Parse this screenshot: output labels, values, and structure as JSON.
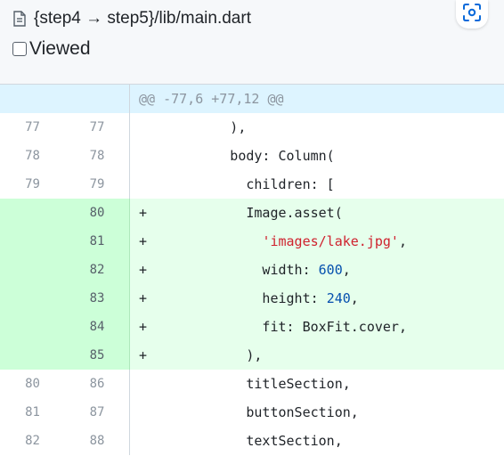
{
  "file": {
    "path": "{step4 → step5}/lib/main.dart",
    "viewed_label": "Viewed",
    "viewed": false
  },
  "icons": {
    "file": "file-diff-icon",
    "scan": "scan-focus-icon"
  },
  "colors": {
    "addition_bg": "#e6ffec",
    "addition_ln_bg": "#ccffd8",
    "hunk_bg": "#ddf4ff",
    "string": "#cf222e",
    "number": "#0550ae"
  },
  "diff": {
    "hunk_header": "@@ -77,6 +77,12 @@",
    "lines": [
      {
        "old": "77",
        "new": "77",
        "marker": "",
        "type": "context",
        "parts": [
          {
            "t": "          ),",
            "k": ""
          }
        ]
      },
      {
        "old": "78",
        "new": "78",
        "marker": "",
        "type": "context",
        "parts": [
          {
            "t": "          body: Column(",
            "k": ""
          }
        ]
      },
      {
        "old": "79",
        "new": "79",
        "marker": "",
        "type": "context",
        "parts": [
          {
            "t": "            children: [",
            "k": ""
          }
        ]
      },
      {
        "old": "",
        "new": "80",
        "marker": "+",
        "type": "add",
        "parts": [
          {
            "t": "            Image.asset(",
            "k": ""
          }
        ]
      },
      {
        "old": "",
        "new": "81",
        "marker": "+",
        "type": "add",
        "parts": [
          {
            "t": "              ",
            "k": ""
          },
          {
            "t": "'images/lake.jpg'",
            "k": "str"
          },
          {
            "t": ",",
            "k": ""
          }
        ]
      },
      {
        "old": "",
        "new": "82",
        "marker": "+",
        "type": "add",
        "parts": [
          {
            "t": "              width: ",
            "k": ""
          },
          {
            "t": "600",
            "k": "num"
          },
          {
            "t": ",",
            "k": ""
          }
        ]
      },
      {
        "old": "",
        "new": "83",
        "marker": "+",
        "type": "add",
        "parts": [
          {
            "t": "              height: ",
            "k": ""
          },
          {
            "t": "240",
            "k": "num"
          },
          {
            "t": ",",
            "k": ""
          }
        ]
      },
      {
        "old": "",
        "new": "84",
        "marker": "+",
        "type": "add",
        "parts": [
          {
            "t": "              fit: BoxFit.cover,",
            "k": ""
          }
        ]
      },
      {
        "old": "",
        "new": "85",
        "marker": "+",
        "type": "add",
        "parts": [
          {
            "t": "            ),",
            "k": ""
          }
        ]
      },
      {
        "old": "80",
        "new": "86",
        "marker": "",
        "type": "context",
        "parts": [
          {
            "t": "            titleSection,",
            "k": ""
          }
        ]
      },
      {
        "old": "81",
        "new": "87",
        "marker": "",
        "type": "context",
        "parts": [
          {
            "t": "            buttonSection,",
            "k": ""
          }
        ]
      },
      {
        "old": "82",
        "new": "88",
        "marker": "",
        "type": "context",
        "parts": [
          {
            "t": "            textSection,",
            "k": ""
          }
        ]
      }
    ]
  }
}
